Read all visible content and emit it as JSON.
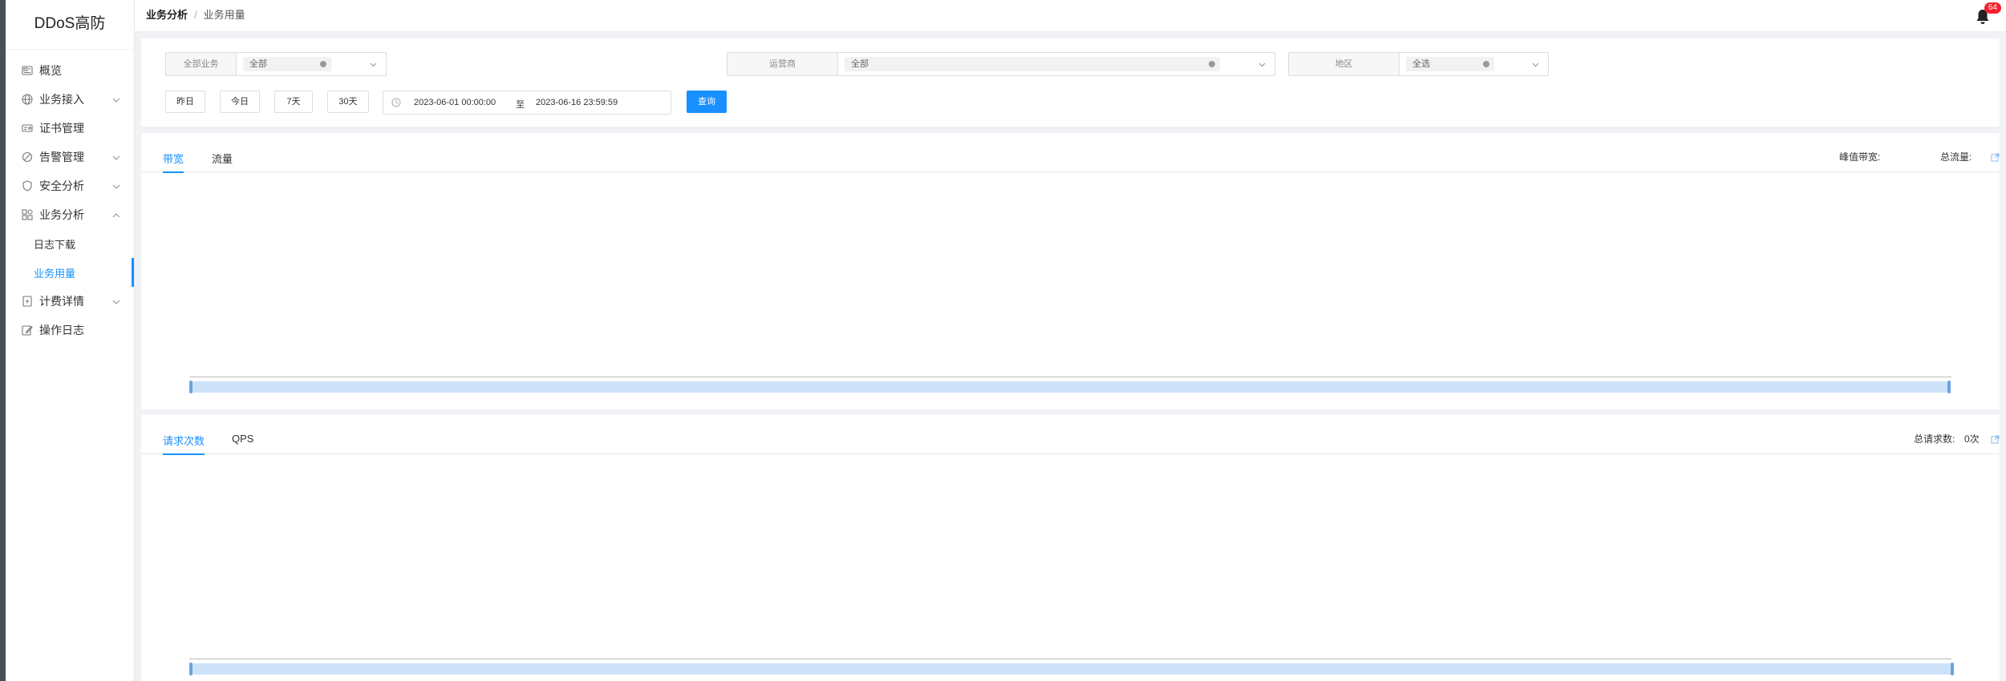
{
  "app": {
    "title": "DDoS高防"
  },
  "sidebar": {
    "items": [
      {
        "label": "概览",
        "icon": "overview-icon"
      },
      {
        "label": "业务接入",
        "icon": "globe-icon"
      },
      {
        "label": "证书管理",
        "icon": "certificate-icon"
      },
      {
        "label": "告警管理",
        "icon": "alarm-icon"
      },
      {
        "label": "安全分析",
        "icon": "shield-icon"
      },
      {
        "label": "业务分析",
        "icon": "analysis-icon"
      }
    ],
    "subitems": [
      {
        "label": "日志下载"
      },
      {
        "label": "业务用量"
      }
    ],
    "items2": [
      {
        "label": "计费详情",
        "icon": "billing-icon"
      },
      {
        "label": "操作日志",
        "icon": "edit-log-icon"
      }
    ]
  },
  "header": {
    "breadcrumb": {
      "parent": "业务分析",
      "separator": "/",
      "current": "业务用量"
    },
    "notifications": "64"
  },
  "filters": {
    "business": {
      "label": "全部业务",
      "value": "全部"
    },
    "operator": {
      "label": "运营商",
      "value": "全部"
    },
    "region": {
      "label": "地区",
      "value": "全选"
    },
    "quick": [
      "昨日",
      "今日",
      "7天",
      "30天"
    ],
    "date_start": "2023-06-01 00:00:00",
    "date_sep": "至",
    "date_end": "2023-06-16 23:59:59",
    "search_label": "查询"
  },
  "panel1": {
    "tabs": [
      "带宽",
      "流量"
    ],
    "peak_label": "峰值带宽:",
    "total_label": "总流量:"
  },
  "panel2": {
    "tabs": [
      "请求次数",
      "QPS"
    ],
    "total_label": "总请求数:",
    "total_value": "0次"
  },
  "colors": {
    "accent": "#1890ff",
    "badge": "#f5222d"
  }
}
